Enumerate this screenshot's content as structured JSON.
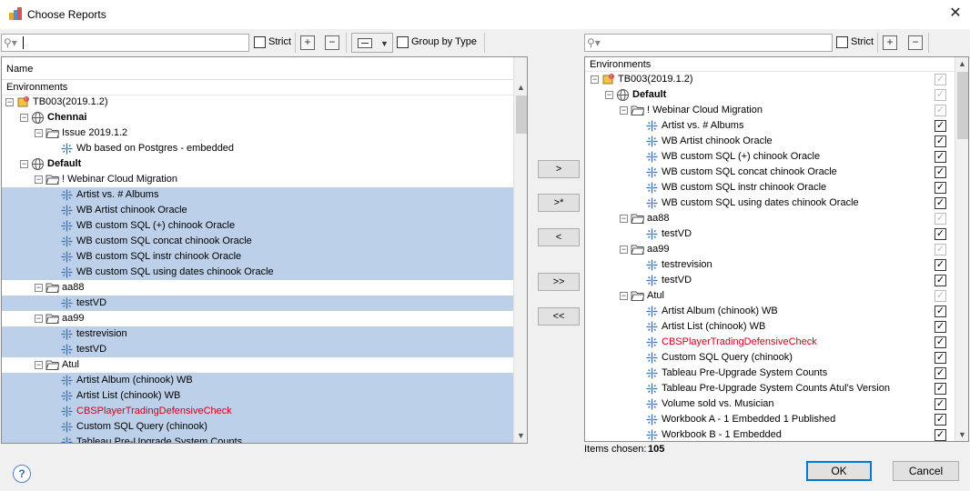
{
  "window": {
    "title": "Choose Reports",
    "close_icon": "close-icon"
  },
  "left_toolbar": {
    "strict_label": "Strict",
    "group_by_type_label": "Group by Type"
  },
  "right_toolbar": {
    "strict_label": "Strict"
  },
  "left_panel": {
    "column_header": "Name",
    "section": "Environments",
    "rows": [
      {
        "label": "TB003(2019.1.2)",
        "level": 0,
        "icon": "server-icon",
        "expander": "⊟",
        "selected": false,
        "style": ""
      },
      {
        "label": "Chennai",
        "level": 1,
        "icon": "globe-icon",
        "expander": "⊟",
        "selected": false,
        "style": "b"
      },
      {
        "label": "Issue 2019.1.2",
        "level": 2,
        "icon": "folder-icon",
        "expander": "⊟",
        "selected": false,
        "style": ""
      },
      {
        "label": "Wb based on Postgres - embedded",
        "level": 3,
        "icon": "workbook-icon",
        "expander": "",
        "selected": false,
        "style": ""
      },
      {
        "label": "Default",
        "level": 1,
        "icon": "globe-icon",
        "expander": "⊟",
        "selected": false,
        "style": "b"
      },
      {
        "label": "! Webinar Cloud Migration",
        "level": 2,
        "icon": "folder-icon",
        "expander": "⊟",
        "selected": false,
        "style": ""
      },
      {
        "label": "Artist vs. # Albums",
        "level": 3,
        "icon": "workbook-icon",
        "expander": "",
        "selected": true,
        "style": ""
      },
      {
        "label": "WB Artist chinook Oracle",
        "level": 3,
        "icon": "workbook-icon",
        "expander": "",
        "selected": true,
        "style": ""
      },
      {
        "label": "WB custom SQL (+) chinook Oracle",
        "level": 3,
        "icon": "workbook-icon",
        "expander": "",
        "selected": true,
        "style": ""
      },
      {
        "label": "WB custom SQL concat chinook Oracle",
        "level": 3,
        "icon": "workbook-icon",
        "expander": "",
        "selected": true,
        "style": ""
      },
      {
        "label": "WB custom SQL instr chinook Oracle",
        "level": 3,
        "icon": "workbook-icon",
        "expander": "",
        "selected": true,
        "style": ""
      },
      {
        "label": "WB custom SQL using dates chinook Oracle",
        "level": 3,
        "icon": "workbook-icon",
        "expander": "",
        "selected": true,
        "style": ""
      },
      {
        "label": "aa88",
        "level": 2,
        "icon": "folder-icon",
        "expander": "⊟",
        "selected": false,
        "style": ""
      },
      {
        "label": "testVD",
        "level": 3,
        "icon": "workbook-icon",
        "expander": "",
        "selected": true,
        "style": ""
      },
      {
        "label": "aa99",
        "level": 2,
        "icon": "folder-icon",
        "expander": "⊟",
        "selected": false,
        "style": ""
      },
      {
        "label": "testrevision",
        "level": 3,
        "icon": "workbook-icon",
        "expander": "",
        "selected": true,
        "style": ""
      },
      {
        "label": "testVD",
        "level": 3,
        "icon": "workbook-icon",
        "expander": "",
        "selected": true,
        "style": ""
      },
      {
        "label": "Atul",
        "level": 2,
        "icon": "folder-icon",
        "expander": "⊟",
        "selected": false,
        "style": ""
      },
      {
        "label": "Artist Album (chinook) WB",
        "level": 3,
        "icon": "workbook-icon",
        "expander": "",
        "selected": true,
        "style": ""
      },
      {
        "label": "Artist List (chinook) WB",
        "level": 3,
        "icon": "workbook-icon",
        "expander": "",
        "selected": true,
        "style": ""
      },
      {
        "label": "CBSPlayerTradingDefensiveCheck",
        "level": 3,
        "icon": "workbook-icon",
        "expander": "",
        "selected": true,
        "style": "red"
      },
      {
        "label": "Custom SQL  Query (chinook)",
        "level": 3,
        "icon": "workbook-icon",
        "expander": "",
        "selected": true,
        "style": ""
      },
      {
        "label": "Tableau Pre-Upgrade System Counts",
        "level": 3,
        "icon": "workbook-icon",
        "expander": "",
        "selected": true,
        "style": ""
      }
    ]
  },
  "middle_buttons": {
    "add": ">",
    "add_all_sel": ">*",
    "remove": "<",
    "add_all": ">>",
    "remove_all": "<<"
  },
  "right_panel": {
    "section": "Environments",
    "rows": [
      {
        "label": "TB003(2019.1.2)",
        "level": 0,
        "icon": "server-icon",
        "expander": "⊟",
        "check": "✓",
        "check_disabled": true,
        "style": ""
      },
      {
        "label": "Default",
        "level": 1,
        "icon": "globe-icon",
        "expander": "⊟",
        "check": "✓",
        "check_disabled": true,
        "style": "b"
      },
      {
        "label": "! Webinar Cloud Migration",
        "level": 2,
        "icon": "folder-icon",
        "expander": "⊟",
        "check": "✓",
        "check_disabled": true,
        "style": ""
      },
      {
        "label": "Artist vs. # Albums",
        "level": 3,
        "icon": "workbook-icon",
        "expander": "",
        "check": "✓",
        "check_disabled": false,
        "style": ""
      },
      {
        "label": "WB Artist chinook Oracle",
        "level": 3,
        "icon": "workbook-icon",
        "expander": "",
        "check": "✓",
        "check_disabled": false,
        "style": ""
      },
      {
        "label": "WB custom SQL (+) chinook Oracle",
        "level": 3,
        "icon": "workbook-icon",
        "expander": "",
        "check": "✓",
        "check_disabled": false,
        "style": ""
      },
      {
        "label": "WB custom SQL concat chinook Oracle",
        "level": 3,
        "icon": "workbook-icon",
        "expander": "",
        "check": "✓",
        "check_disabled": false,
        "style": ""
      },
      {
        "label": "WB custom SQL instr chinook Oracle",
        "level": 3,
        "icon": "workbook-icon",
        "expander": "",
        "check": "✓",
        "check_disabled": false,
        "style": ""
      },
      {
        "label": "WB custom SQL using dates chinook Oracle",
        "level": 3,
        "icon": "workbook-icon",
        "expander": "",
        "check": "✓",
        "check_disabled": false,
        "style": ""
      },
      {
        "label": "aa88",
        "level": 2,
        "icon": "folder-icon",
        "expander": "⊟",
        "check": "✓",
        "check_disabled": true,
        "style": ""
      },
      {
        "label": "testVD",
        "level": 3,
        "icon": "workbook-icon",
        "expander": "",
        "check": "✓",
        "check_disabled": false,
        "style": ""
      },
      {
        "label": "aa99",
        "level": 2,
        "icon": "folder-icon",
        "expander": "⊟",
        "check": "✓",
        "check_disabled": true,
        "style": ""
      },
      {
        "label": "testrevision",
        "level": 3,
        "icon": "workbook-icon",
        "expander": "",
        "check": "✓",
        "check_disabled": false,
        "style": ""
      },
      {
        "label": "testVD",
        "level": 3,
        "icon": "workbook-icon",
        "expander": "",
        "check": "✓",
        "check_disabled": false,
        "style": ""
      },
      {
        "label": "Atul",
        "level": 2,
        "icon": "folder-icon",
        "expander": "⊟",
        "check": "✓",
        "check_disabled": true,
        "style": ""
      },
      {
        "label": "Artist Album (chinook) WB",
        "level": 3,
        "icon": "workbook-icon",
        "expander": "",
        "check": "✓",
        "check_disabled": false,
        "style": ""
      },
      {
        "label": "Artist List (chinook) WB",
        "level": 3,
        "icon": "workbook-icon",
        "expander": "",
        "check": "✓",
        "check_disabled": false,
        "style": ""
      },
      {
        "label": "CBSPlayerTradingDefensiveCheck",
        "level": 3,
        "icon": "workbook-icon",
        "expander": "",
        "check": "✓",
        "check_disabled": false,
        "style": "red"
      },
      {
        "label": "Custom SQL  Query (chinook)",
        "level": 3,
        "icon": "workbook-icon",
        "expander": "",
        "check": "✓",
        "check_disabled": false,
        "style": ""
      },
      {
        "label": "Tableau Pre-Upgrade System Counts",
        "level": 3,
        "icon": "workbook-icon",
        "expander": "",
        "check": "✓",
        "check_disabled": false,
        "style": ""
      },
      {
        "label": "Tableau Pre-Upgrade System Counts Atul's Version",
        "level": 3,
        "icon": "workbook-icon",
        "expander": "",
        "check": "✓",
        "check_disabled": false,
        "style": ""
      },
      {
        "label": "Volume sold vs. Musician",
        "level": 3,
        "icon": "workbook-icon",
        "expander": "",
        "check": "✓",
        "check_disabled": false,
        "style": ""
      },
      {
        "label": "Workbook A - 1 Embedded 1 Published",
        "level": 3,
        "icon": "workbook-icon",
        "expander": "",
        "check": "✓",
        "check_disabled": false,
        "style": ""
      },
      {
        "label": "Workbook B - 1 Embedded",
        "level": 3,
        "icon": "workbook-icon",
        "expander": "",
        "check": "✓",
        "check_disabled": false,
        "style": ""
      }
    ]
  },
  "footer": {
    "items_chosen_label": "Items chosen:",
    "items_chosen_count": "105",
    "ok": "OK",
    "cancel": "Cancel",
    "help_icon": "?"
  },
  "colors": {
    "selection": "#bcd0e9",
    "error_text": "#d0021b",
    "ok_border": "#0078d7"
  }
}
